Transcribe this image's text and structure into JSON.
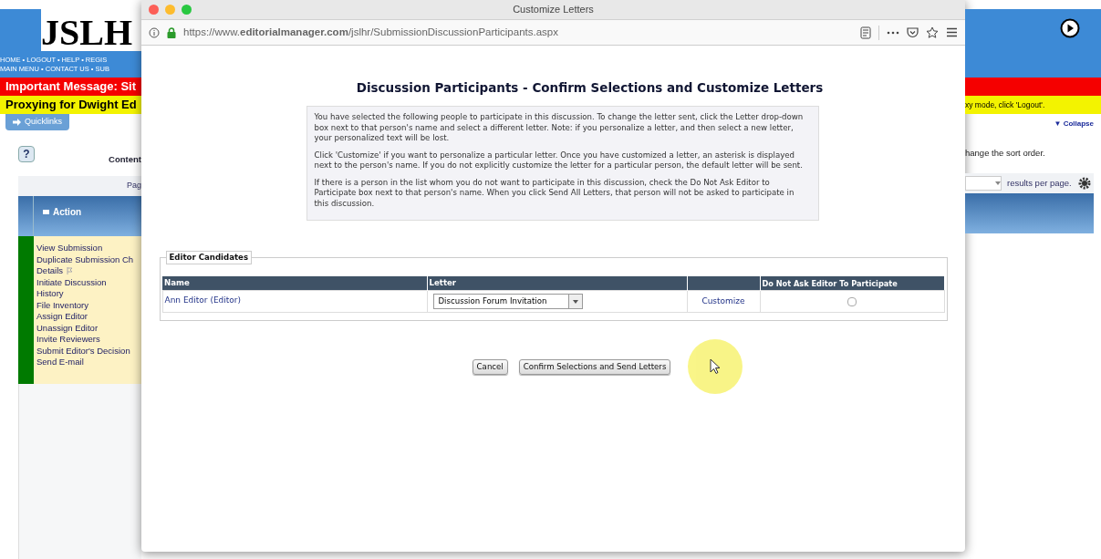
{
  "background_page": {
    "logo": "JSLH",
    "nav_lines": [
      "HOME • LOGOUT • HELP • REGIS",
      "MAIN MENU • CONTACT US • SUB"
    ],
    "important_message": "Important Message: Sit",
    "proxy_message_left": "Proxying for Dwight Ed",
    "proxy_message_right": "xy mode, click 'Logout'.",
    "quicklinks": "Quicklinks",
    "help": "?",
    "content_heading": "Content",
    "collapse": "▼ Collapse",
    "sort_hint": "hange the sort order.",
    "pager": "Pag",
    "results_per_page": "results per page.",
    "action_header": "Action",
    "actions": [
      {
        "label": "View Submission",
        "flagged": false
      },
      {
        "label": "Duplicate Submission Ch",
        "flagged": false
      },
      {
        "label": "Details",
        "flagged": true
      },
      {
        "label": "Initiate Discussion",
        "flagged": false
      },
      {
        "label": "History",
        "flagged": false
      },
      {
        "label": "File Inventory",
        "flagged": false
      },
      {
        "label": "Assign Editor",
        "flagged": false
      },
      {
        "label": "Unassign Editor",
        "flagged": false
      },
      {
        "label": "Invite Reviewers",
        "flagged": false
      },
      {
        "label": "Submit Editor's Decision",
        "flagged": false
      },
      {
        "label": "Send E-mail",
        "flagged": false
      }
    ]
  },
  "dialog": {
    "title": "Customize Letters",
    "url": "https://www.**editorialmanager.com**/jslhr/SubmissionDiscussionParticipants.aspx",
    "heading": "Discussion Participants - Confirm Selections and Customize Letters",
    "paragraphs": [
      "You have selected the following people to participate in this discussion. To change the letter sent, click the Letter drop-down box next to that person's name and select a different letter. Note: if you personalize a letter, and then select a new letter, your personalized text will be lost.",
      "Click 'Customize' if you want to personalize a particular letter. Once you have customized a letter, an asterisk is displayed next to the person's name. If you do not explicitly customize the letter for a particular person, the default letter will be sent.",
      "If there is a person in the list whom you do not want to participate in this discussion, check the Do Not Ask Editor to Participate box next to that person's name. When you click Send All Letters, that person will not be asked to participate in this discussion."
    ],
    "legend": "Editor Candidates",
    "columns": {
      "name": "Name",
      "letter": "Letter",
      "do_not_ask": "Do Not Ask Editor To Participate"
    },
    "rows": [
      {
        "name": "Ann Editor (Editor)",
        "letter": "Discussion Forum Invitation",
        "customize": "Customize",
        "do_not_ask": false
      }
    ],
    "buttons": [
      "Cancel",
      "Confirm Selections and Send Letters"
    ]
  }
}
